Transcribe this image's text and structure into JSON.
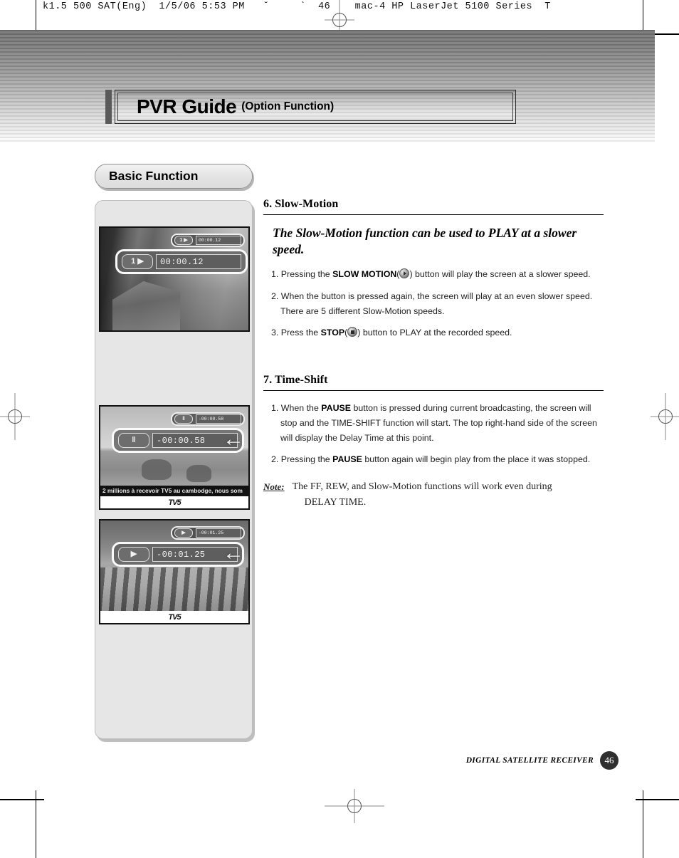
{
  "plate": {
    "info_line": "k1.5 500 SAT(Eng)  1/5/06 5:53 PM   ˘     `  46    mac-4 HP LaserJet 5100 Series  T"
  },
  "header": {
    "title_main": "PVR Guide",
    "title_sub": "(Option Function)"
  },
  "tab": {
    "label": "Basic Function"
  },
  "sidebar": {
    "screenshots": [
      {
        "name": "slow-motion-screenshot",
        "osd_icon": "1 ▶",
        "osd_time": "00:00.12",
        "subtitle": "",
        "logo": "",
        "arrow": ""
      },
      {
        "name": "pause-timeshift-screenshot",
        "osd_icon": "‖",
        "osd_time": "-00:00.58",
        "subtitle": "2 millions à recevoir TV5 au cambodge, nous som",
        "logo": "TV5",
        "arrow": "←"
      },
      {
        "name": "play-resume-screenshot",
        "osd_icon": "▶",
        "osd_time": "-00:01.25",
        "subtitle": "",
        "logo": "TV5",
        "arrow": "←"
      }
    ]
  },
  "sections": [
    {
      "heading": "6. Slow-Motion",
      "lead": "The Slow-Motion function can be used to PLAY at a slower speed.",
      "steps": [
        {
          "num": "1.",
          "pre": "Pressing the ",
          "strong": "SLOW MOTION",
          "icon": "play-button-icon",
          "post": " button will play the screen at a slower speed."
        },
        {
          "num": "2.",
          "pre": "When the button is pressed again, the screen will play at an even slower speed. There are 5 different Slow-Motion speeds.",
          "strong": "",
          "icon": "",
          "post": ""
        },
        {
          "num": "3.",
          "pre": "Press the ",
          "strong": "STOP",
          "icon": "stop-button-icon",
          "post": " button to PLAY at the recorded speed."
        }
      ]
    },
    {
      "heading": "7. Time-Shift",
      "lead": "",
      "steps": [
        {
          "num": "1.",
          "pre": "When the ",
          "strong": "PAUSE",
          "icon": "",
          "post": " button is pressed during current broadcasting, the screen will stop and the TIME-SHIFT function will start. The top right-hand side of the screen will display the Delay Time at this point."
        },
        {
          "num": "2.",
          "pre": "Pressing the ",
          "strong": "PAUSE",
          "icon": "",
          "post": " button again will begin play from the place it was stopped."
        }
      ],
      "note": {
        "label": "Note:",
        "line1": "The FF, REW, and Slow-Motion functions will work even during",
        "line2": "DELAY TIME."
      }
    }
  ],
  "footer": {
    "text": "DIGITAL SATELLITE RECEIVER",
    "page": "46"
  },
  "colors": {
    "band_dark": "#6f6f6f",
    "panel_bg": "#e6e6e6",
    "accent_bar": "#5a5a5a",
    "page_badge": "#2f2f2f"
  }
}
